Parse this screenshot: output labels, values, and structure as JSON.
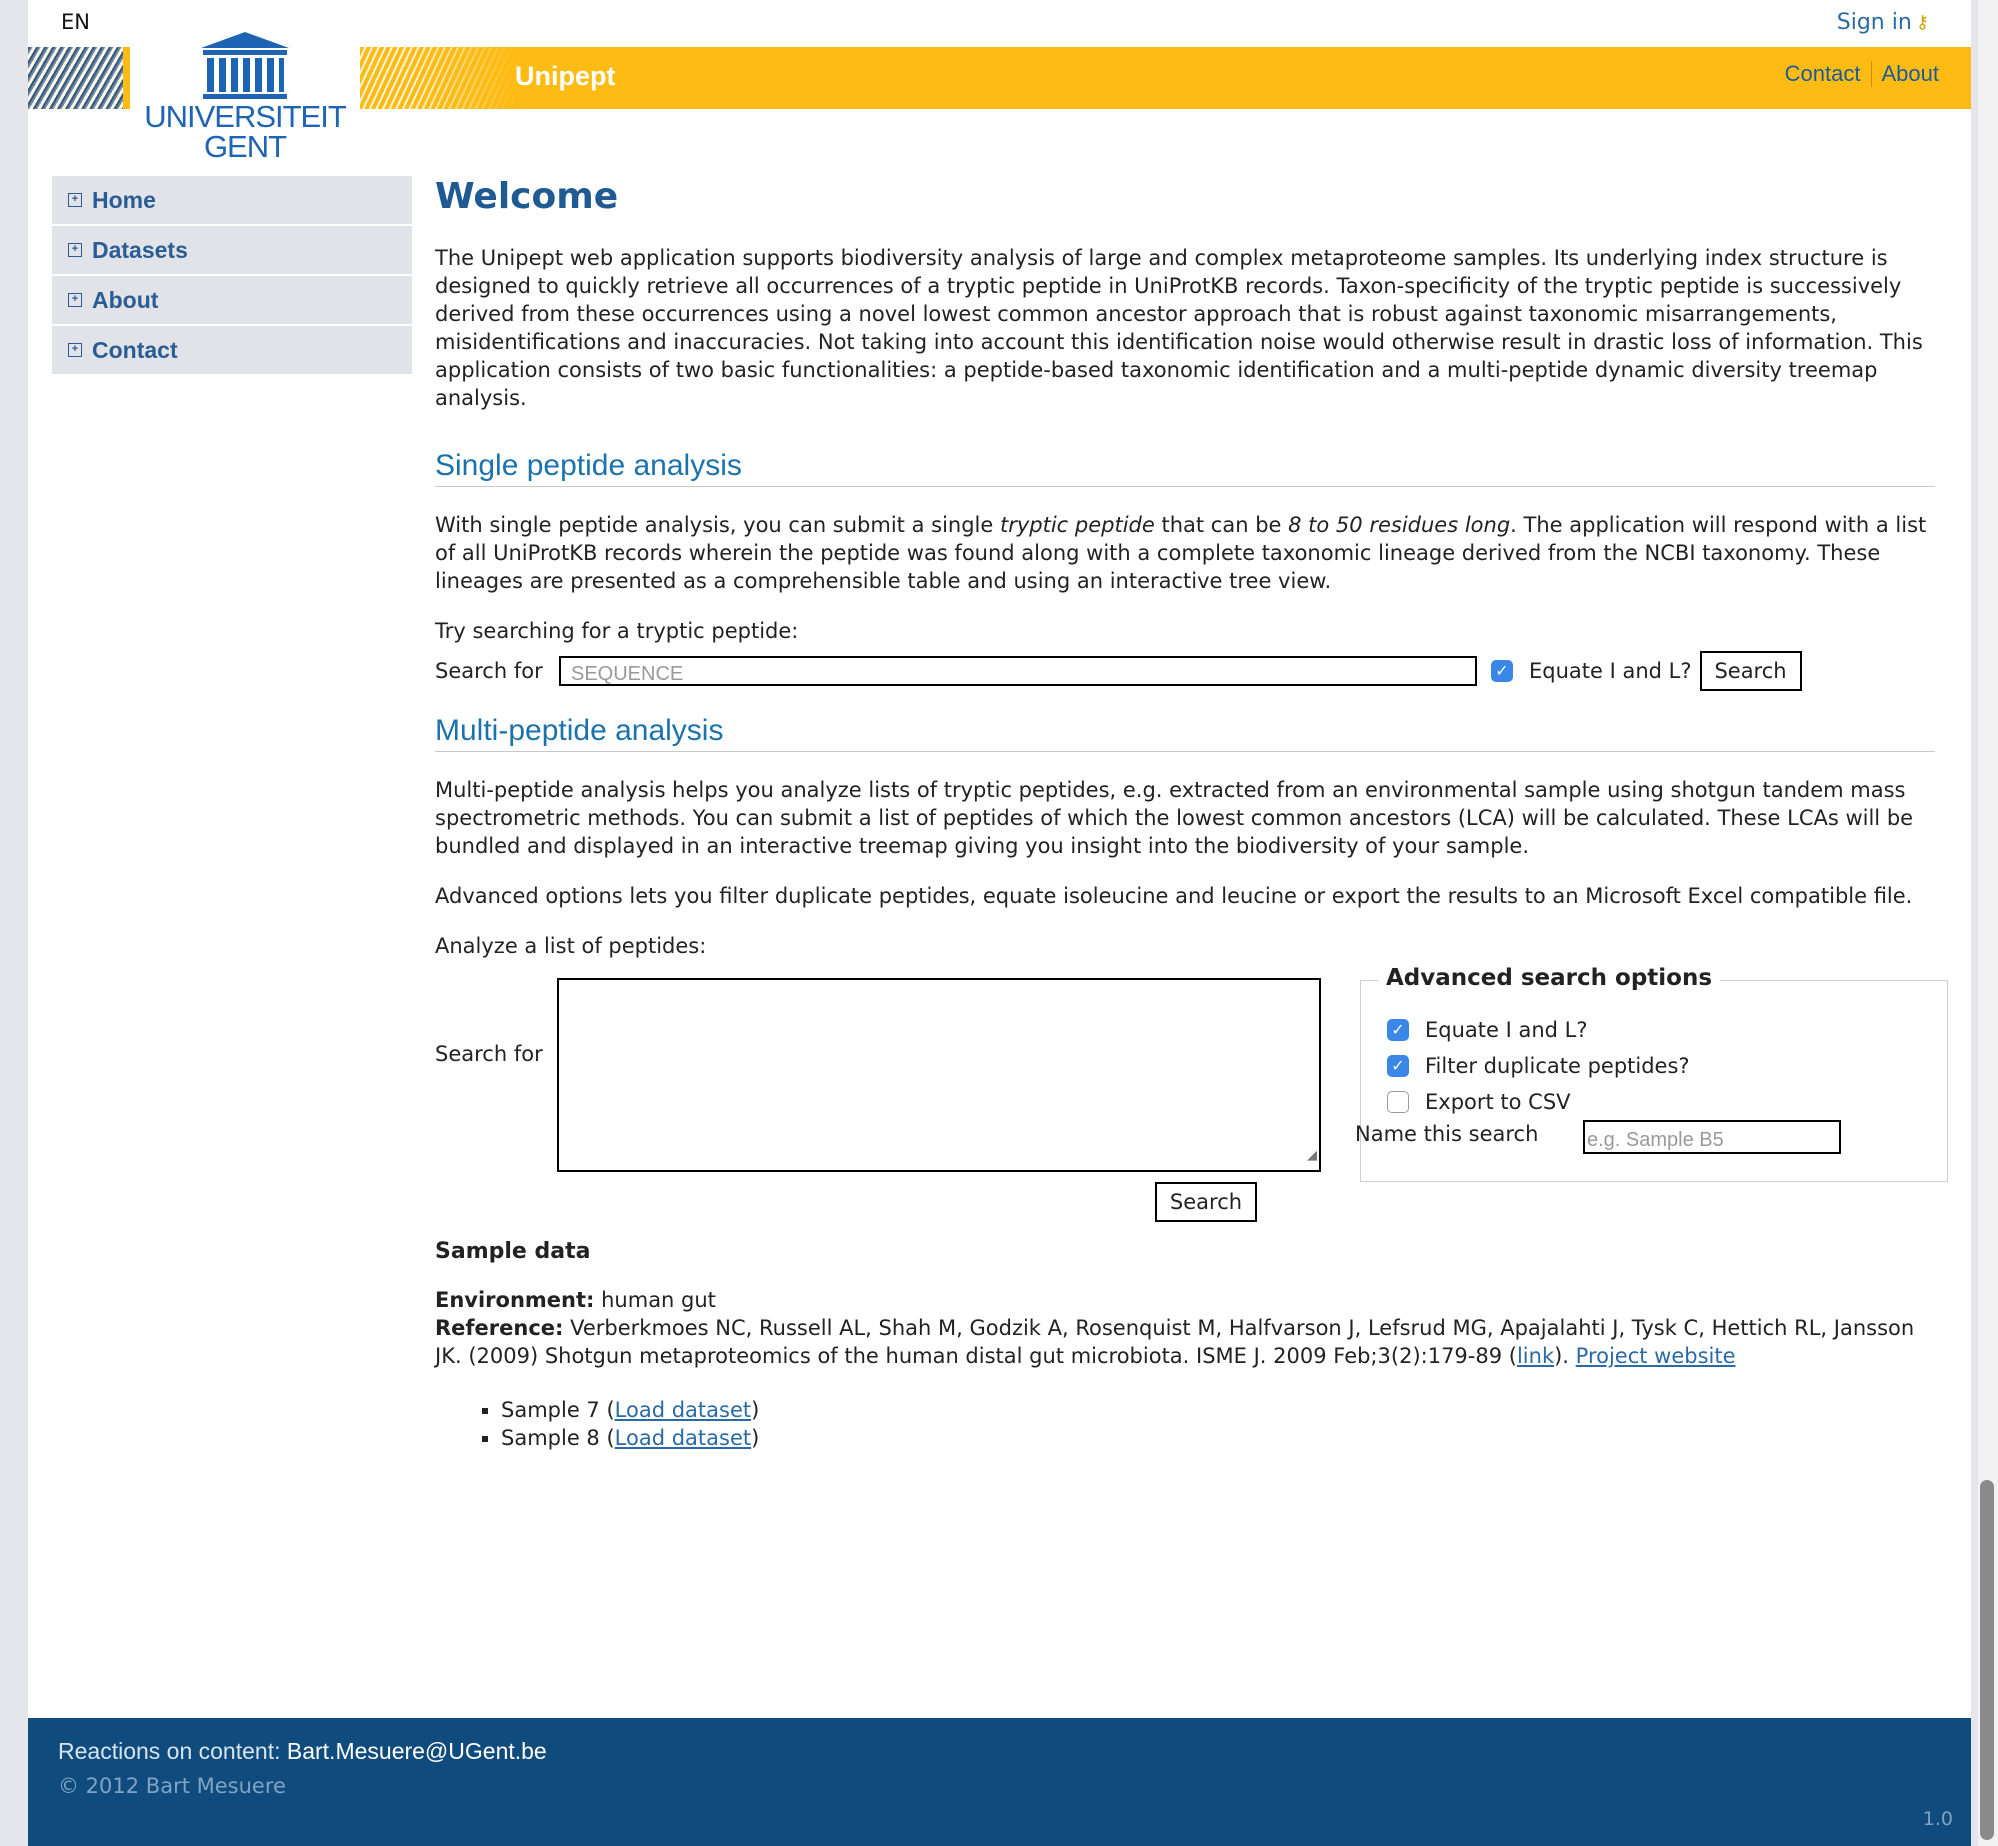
{
  "header": {
    "lang": "EN",
    "sign_in": "Sign in",
    "brand": "Unipept",
    "nav": [
      "Contact",
      "About"
    ],
    "logo_line1": "UNIVERSITEIT",
    "logo_line2": "GENT"
  },
  "sidebar": {
    "items": [
      {
        "label": "Home"
      },
      {
        "label": "Datasets"
      },
      {
        "label": "About"
      },
      {
        "label": "Contact"
      }
    ]
  },
  "main": {
    "title": "Welcome",
    "intro": "The Unipept web application supports biodiversity analysis of large and complex metaproteome samples. Its underlying index structure is designed to quickly retrieve all occurrences of a tryptic peptide in UniProtKB records. Taxon-specificity of the tryptic peptide is successively derived from these occurrences using a novel lowest common ancestor approach that is robust against taxonomic misarrangements, misidentifications and inaccuracies. Not taking into account this identification noise would otherwise result in drastic loss of information. This application consists of two basic functionalities: a peptide-based taxonomic identification and a multi-peptide dynamic diversity treemap analysis.",
    "single": {
      "heading": "Single peptide analysis",
      "p1_a": "With single peptide analysis, you can submit a single ",
      "p1_em1": "tryptic peptide",
      "p1_b": " that can be ",
      "p1_em2": "8 to 50 residues long",
      "p1_c": ". The application will respond with a list of all UniProtKB records wherein the peptide was found along with a complete taxonomic lineage derived from the NCBI taxonomy. These lineages are presented as a comprehensible table and using an interactive tree view.",
      "try": "Try searching for a tryptic peptide:",
      "search_label": "Search for",
      "placeholder": "SEQUENCE",
      "equate_label": "Equate I and L?",
      "equate_checked": true,
      "button": "Search"
    },
    "multi": {
      "heading": "Multi-peptide analysis",
      "p1": "Multi-peptide analysis helps you analyze lists of tryptic peptides, e.g. extracted from an environmental sample using shotgun tandem mass spectrometric methods. You can submit a list of peptides of which the lowest common ancestors (LCA) will be calculated. These LCAs will be bundled and displayed in an interactive treemap giving you insight into the biodiversity of your sample.",
      "p2": "Advanced options lets you filter duplicate peptides, equate isoleucine and leucine or export the results to an Microsoft Excel compatible file.",
      "analyze": "Analyze a list of peptides:",
      "search_label": "Search for",
      "button": "Search",
      "advanced": {
        "legend": "Advanced search options",
        "options": [
          {
            "label": "Equate I and L?",
            "checked": true
          },
          {
            "label": "Filter duplicate peptides?",
            "checked": true
          },
          {
            "label": "Export to CSV",
            "checked": false
          }
        ],
        "name_label": "Name this search",
        "name_placeholder": "e.g. Sample B5"
      }
    },
    "sample": {
      "heading": "Sample data",
      "env_label": "Environment:",
      "env_value": " human gut",
      "ref_label": "Reference:",
      "ref_text": " Verberkmoes NC, Russell AL, Shah M, Godzik A, Rosenquist M, Halfvarson J, Lefsrud MG, Apajalahti J, Tysk C, Hettich RL, Jansson JK. (2009) Shotgun metaproteomics of the human distal gut microbiota. ISME J. 2009 Feb;3(2):179-89 (",
      "ref_link": "link",
      "ref_after": "). ",
      "project_link": "Project website",
      "samples": [
        {
          "name": "Sample 7",
          "link": "Load dataset"
        },
        {
          "name": "Sample 8",
          "link": "Load dataset"
        }
      ]
    }
  },
  "footer": {
    "reactions_label": "Reactions on content",
    "colon": ": ",
    "email": "Bart.Mesuere@UGent.be",
    "copyright": "© 2012 Bart Mesuere",
    "version": "1.0"
  },
  "colors": {
    "banner": "#fdbb14",
    "footer": "#0f4b7c",
    "heading_blue": "#1f5a92",
    "link_blue": "#2a6aa5",
    "checkbox_blue": "#3a87e8"
  }
}
